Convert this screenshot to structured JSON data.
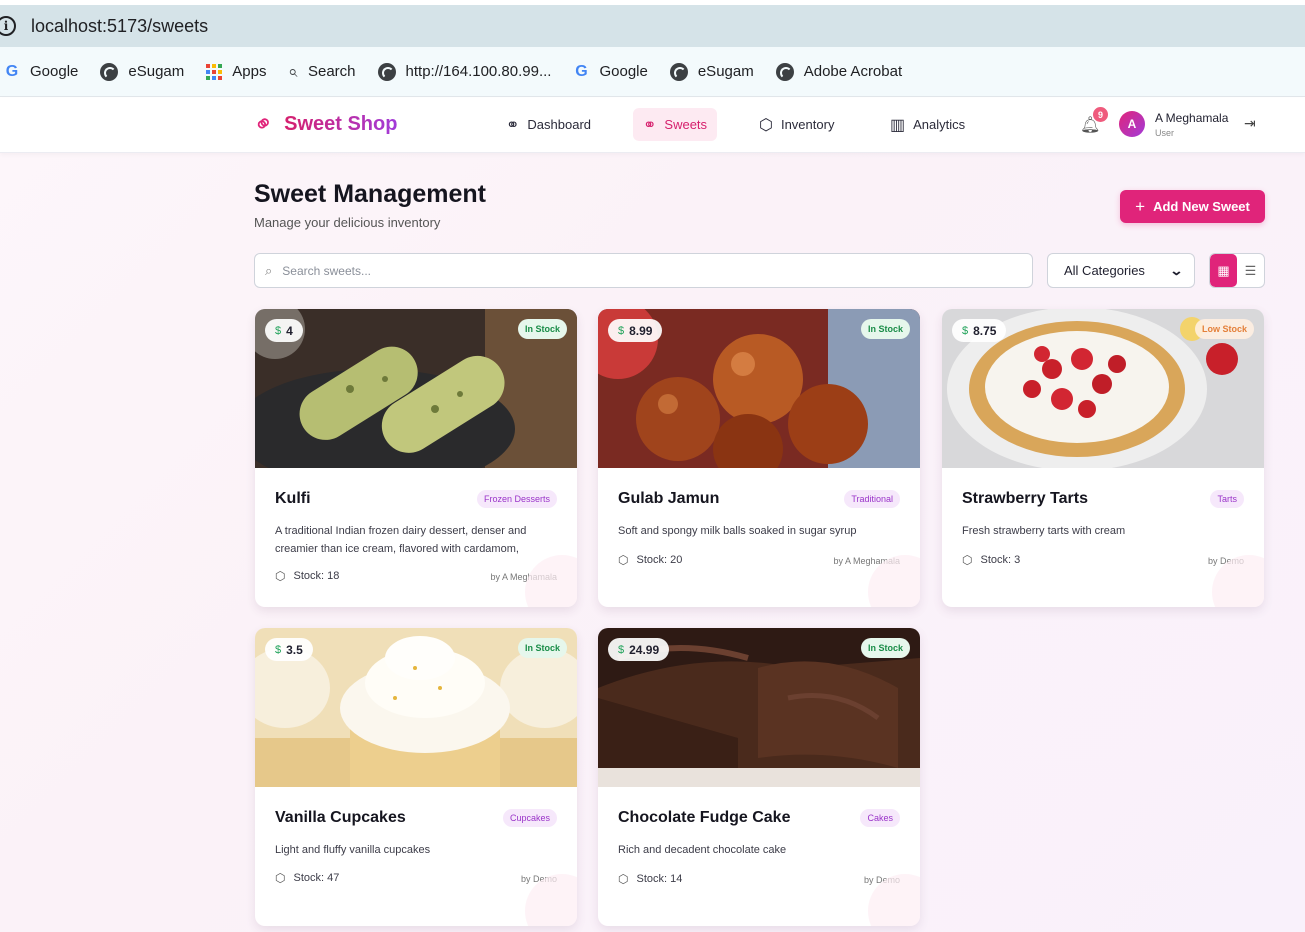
{
  "browser": {
    "url": "localhost:5173/sweets",
    "bookmarks": [
      {
        "label": "Google",
        "icon": "google-icon"
      },
      {
        "label": "eSugam",
        "icon": "globe-icon"
      },
      {
        "label": "Apps",
        "icon": "apps-grid-icon"
      },
      {
        "label": "Search",
        "icon": "search-icon"
      },
      {
        "label": "http://164.100.80.99...",
        "icon": "globe-icon"
      },
      {
        "label": "Google",
        "icon": "google-icon"
      },
      {
        "label": "eSugam",
        "icon": "globe-icon"
      },
      {
        "label": "Adobe Acrobat",
        "icon": "globe-icon"
      }
    ]
  },
  "header": {
    "brand": "Sweet Shop",
    "nav": [
      {
        "label": "Dashboard",
        "icon": "candy-icon",
        "active": false
      },
      {
        "label": "Sweets",
        "icon": "candy-icon",
        "active": true
      },
      {
        "label": "Inventory",
        "icon": "box-icon",
        "active": false
      },
      {
        "label": "Analytics",
        "icon": "bar-chart-icon",
        "active": false
      }
    ],
    "notification_count": "9",
    "user": {
      "initial": "A",
      "name": "A Meghamala",
      "role": "User"
    }
  },
  "page": {
    "title": "Sweet Management",
    "subtitle": "Manage your delicious inventory",
    "add_button": "Add New Sweet",
    "search_placeholder": "Search sweets...",
    "category_filter": "All Categories",
    "view_mode": "grid"
  },
  "sweets": [
    {
      "name": "Kulfi",
      "price": "4",
      "stock_status": "In Stock",
      "category": "Frozen Desserts",
      "description": "A traditional Indian frozen dairy dessert, denser and creamier than ice cream, flavored with cardamom, saffron and pistachios.",
      "stock": "Stock: 18",
      "by": "by A Meghamala"
    },
    {
      "name": "Gulab Jamun",
      "price": "8.99",
      "stock_status": "In Stock",
      "category": "Traditional",
      "description": "Soft and spongy milk balls soaked in sugar syrup",
      "stock": "Stock: 20",
      "by": "by A Meghamala"
    },
    {
      "name": "Strawberry Tarts",
      "price": "8.75",
      "stock_status": "Low Stock",
      "category": "Tarts",
      "description": "Fresh strawberry tarts with cream",
      "stock": "Stock: 3",
      "by": "by Demo"
    },
    {
      "name": "Vanilla Cupcakes",
      "price": "3.5",
      "stock_status": "In Stock",
      "category": "Cupcakes",
      "description": "Light and fluffy vanilla cupcakes",
      "stock": "Stock: 47",
      "by": "by Demo"
    },
    {
      "name": "Chocolate Fudge Cake",
      "price": "24.99",
      "stock_status": "In Stock",
      "category": "Cakes",
      "description": "Rich and decadent chocolate cake",
      "stock": "Stock: 14",
      "by": "by Demo"
    }
  ],
  "colors": {
    "accent": "#e0247a",
    "purple": "#a23bd9",
    "in_stock": "#1a8d48",
    "low_stock": "#e4803a"
  }
}
